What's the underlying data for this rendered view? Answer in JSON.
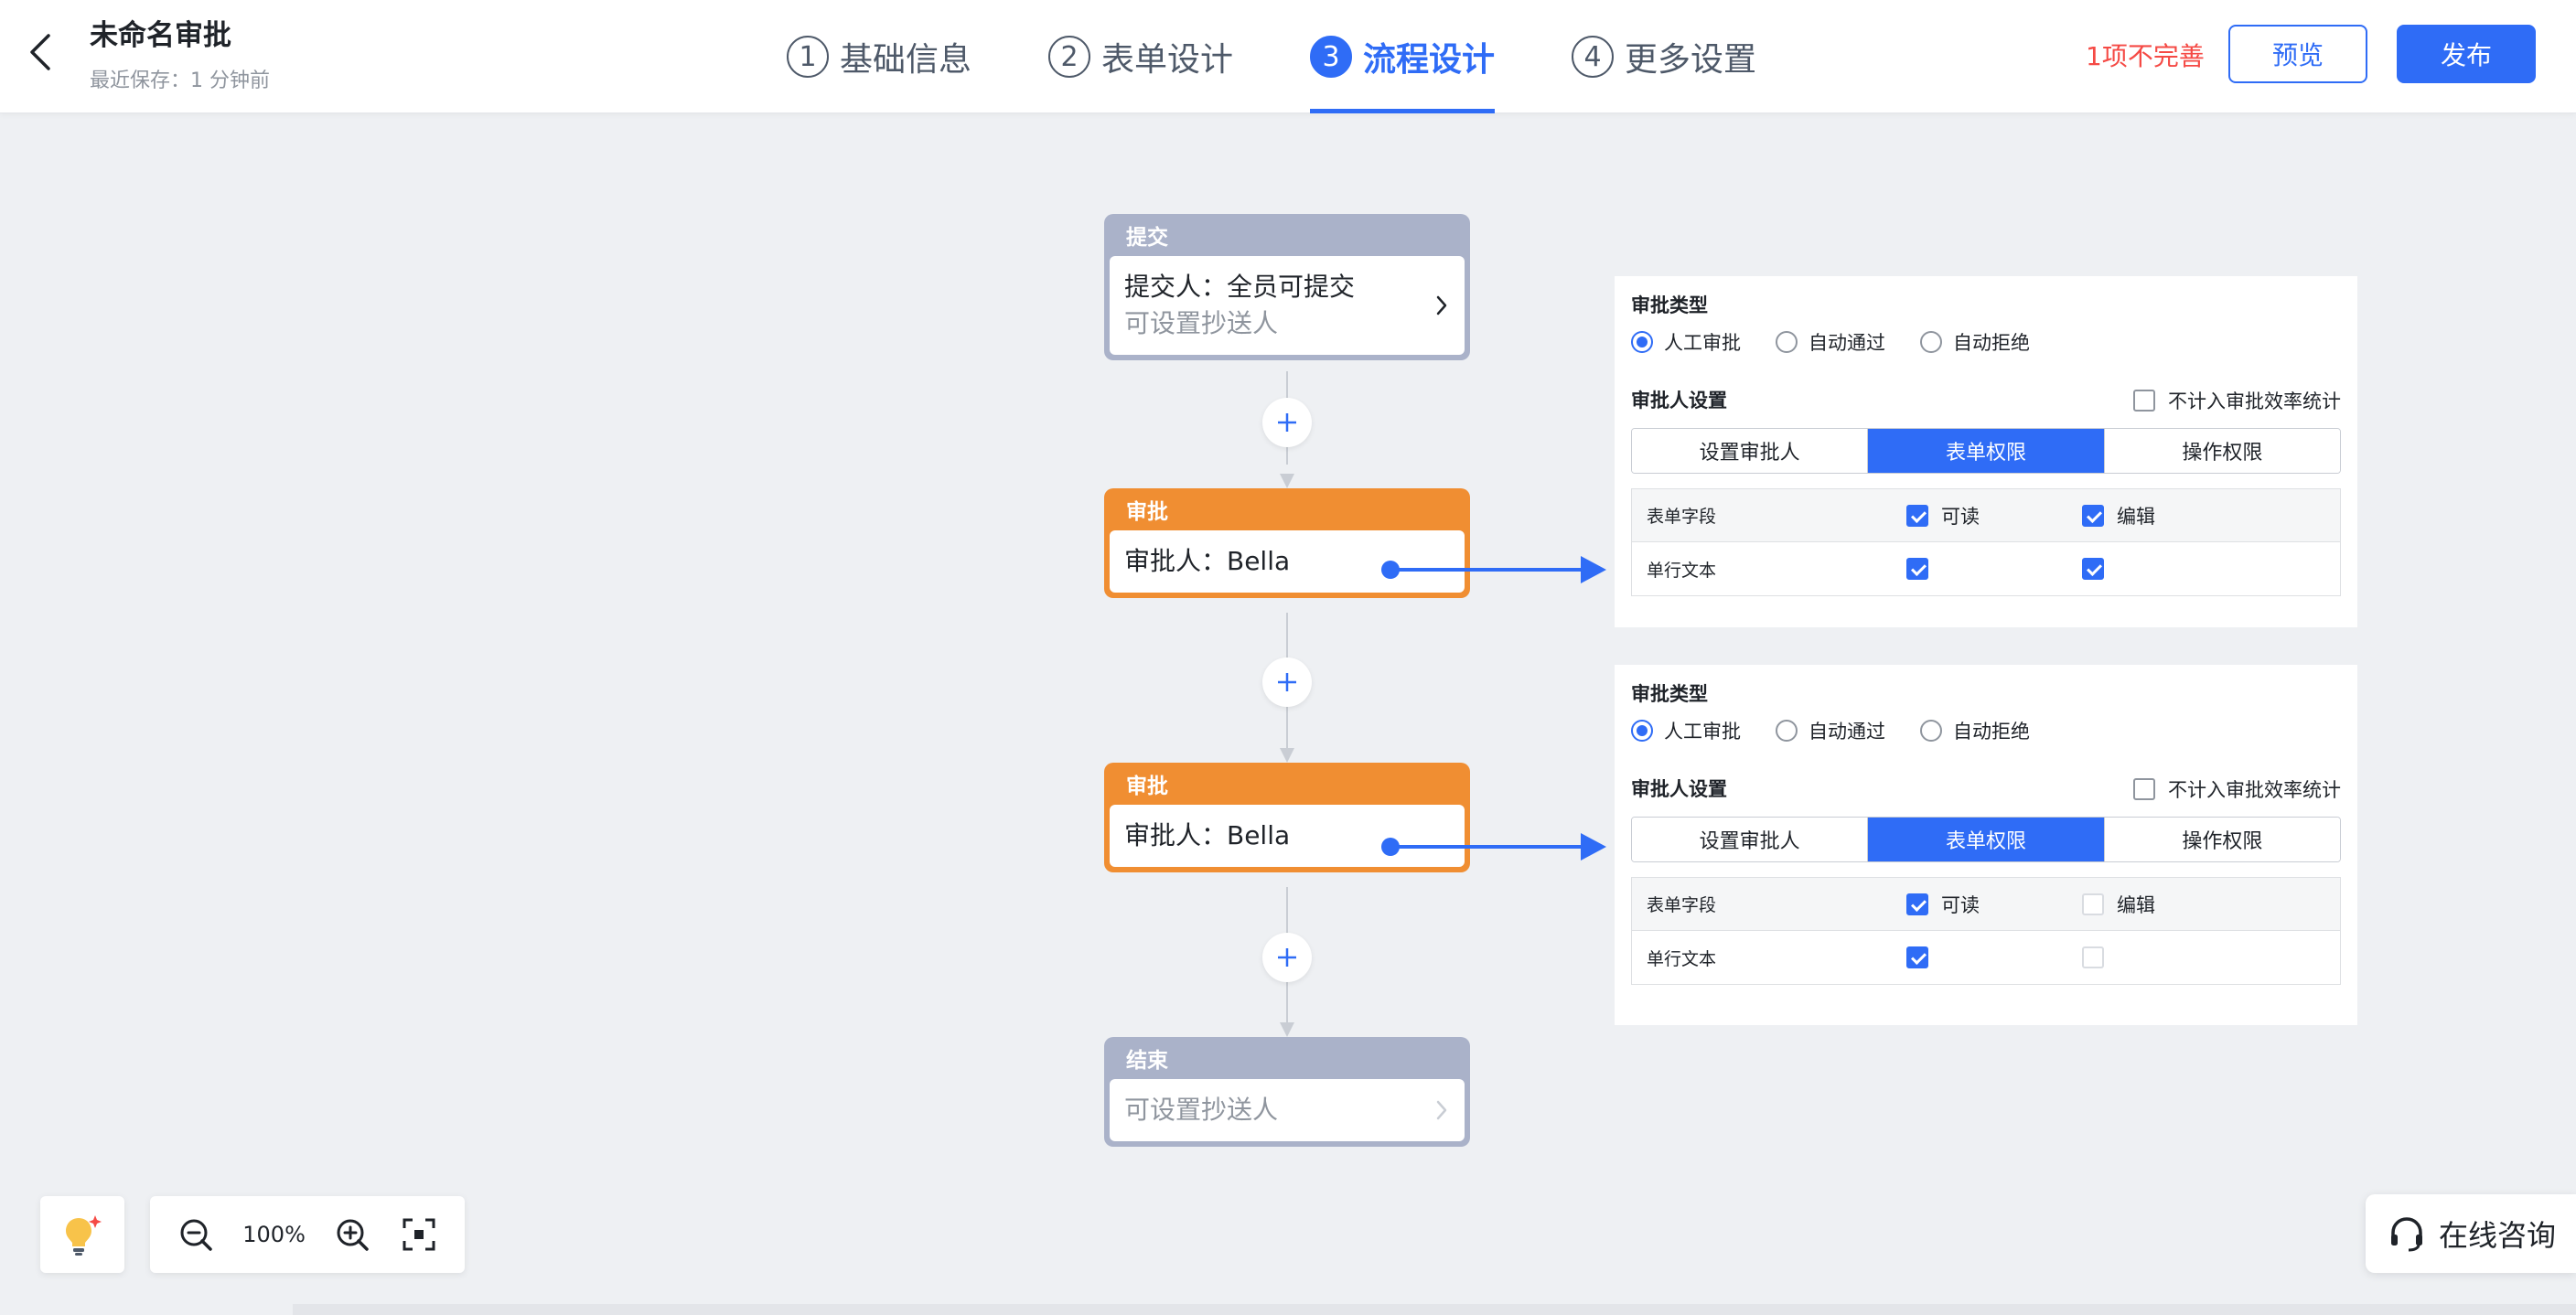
{
  "header": {
    "title": "未命名审批",
    "save_hint": "最近保存：1 分钟前",
    "incomplete": "1项不完善",
    "preview_label": "预览",
    "publish_label": "发布"
  },
  "steps": [
    {
      "num": "1",
      "label": "基础信息",
      "active": false
    },
    {
      "num": "2",
      "label": "表单设计",
      "active": false
    },
    {
      "num": "3",
      "label": "流程设计",
      "active": true
    },
    {
      "num": "4",
      "label": "更多设置",
      "active": false
    }
  ],
  "flow": {
    "submit": {
      "head": "提交",
      "line1": "提交人：全员可提交",
      "line2": "可设置抄送人"
    },
    "approve1": {
      "head": "审批",
      "line1": "审批人：Bella"
    },
    "approve2": {
      "head": "审批",
      "line1": "审批人：Bella"
    },
    "end": {
      "head": "结束",
      "line2": "可设置抄送人"
    }
  },
  "panels": [
    {
      "type_title": "审批类型",
      "radios": [
        "人工审批",
        "自动通过",
        "自动拒绝"
      ],
      "radio_selected": 0,
      "approver_title": "审批人设置",
      "exclude_label": "不计入审批效率统计",
      "exclude_checked": false,
      "tabs": [
        "设置审批人",
        "表单权限",
        "操作权限"
      ],
      "tab_active": 1,
      "table": {
        "header": {
          "field": "表单字段",
          "read": "可读",
          "edit": "编辑",
          "read_checked": true,
          "edit_checked": true
        },
        "rows": [
          {
            "field": "单行文本",
            "read_checked": true,
            "edit_checked": true
          }
        ]
      }
    },
    {
      "type_title": "审批类型",
      "radios": [
        "人工审批",
        "自动通过",
        "自动拒绝"
      ],
      "radio_selected": 0,
      "approver_title": "审批人设置",
      "exclude_label": "不计入审批效率统计",
      "exclude_checked": false,
      "tabs": [
        "设置审批人",
        "表单权限",
        "操作权限"
      ],
      "tab_active": 1,
      "table": {
        "header": {
          "field": "表单字段",
          "read": "可读",
          "edit": "编辑",
          "read_checked": true,
          "edit_checked": false
        },
        "rows": [
          {
            "field": "单行文本",
            "read_checked": true,
            "edit_checked": false
          }
        ]
      }
    }
  ],
  "zoom": {
    "value": "100%"
  },
  "consult": {
    "label": "在线咨询"
  },
  "colors": {
    "accent": "#2f6cf6",
    "approve_node": "#f08e32",
    "gray_node": "#aab2c9",
    "warning": "#f54a45"
  },
  "icons": {
    "back": "chevron-left-icon",
    "node_arrow": "chevron-right-icon",
    "add": "plus-icon",
    "bulb": "lightbulb-icon",
    "zoom_out": "zoom-out-icon",
    "zoom_in": "zoom-in-icon",
    "fit": "fit-screen-icon",
    "headset": "headset-icon"
  }
}
